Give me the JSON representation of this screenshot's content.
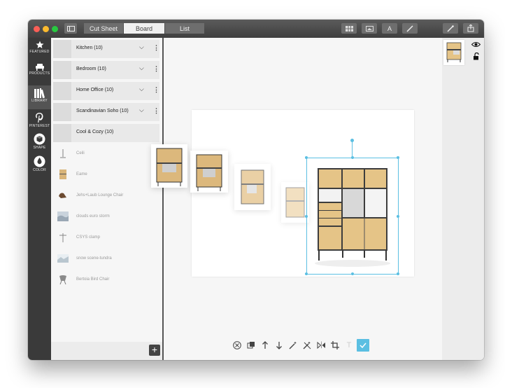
{
  "window": {
    "tabs": [
      {
        "label": "Cut Sheet",
        "active": false
      },
      {
        "label": "Board",
        "active": true
      },
      {
        "label": "List",
        "active": false
      }
    ]
  },
  "sidebar_rail": {
    "items": [
      {
        "label": "FEATURED",
        "icon": "star-icon"
      },
      {
        "label": "PRODUCTS",
        "icon": "armchair-icon"
      },
      {
        "label": "LIBRARY",
        "icon": "books-icon",
        "active": true
      },
      {
        "label": "PINTEREST",
        "icon": "pinterest-icon"
      },
      {
        "label": "SHAPE",
        "icon": "shape-icon"
      },
      {
        "label": "COLOR",
        "icon": "droplet-icon"
      }
    ]
  },
  "library": {
    "collections": [
      {
        "label": "Kitchen (10)"
      },
      {
        "label": "Bedroom (10)"
      },
      {
        "label": "Home Office (10)"
      },
      {
        "label": "Scandinavian Soho (10)"
      },
      {
        "label": "Cool & Cozy (10)"
      }
    ],
    "items": [
      {
        "label": "Ceili"
      },
      {
        "label": "Eame"
      },
      {
        "label": "Jehs+Laub Lounge Chair"
      },
      {
        "label": "clouds euro storm"
      },
      {
        "label": "CSYS clamp"
      },
      {
        "label": "snow scene-tundra"
      },
      {
        "label": "Bertoia Bird Chair"
      }
    ]
  },
  "toolbar": {
    "icons": [
      "close-circle-icon",
      "duplicate-icon",
      "bring-forward-icon",
      "send-backward-icon",
      "magic-wand-icon",
      "magic-wand-off-icon",
      "flip-icon",
      "crop-icon",
      "text-icon",
      "confirm-check-icon"
    ]
  },
  "colors": {
    "selection": "#5bbfe2",
    "titlebar": "#4a4a4a",
    "rail": "#3a3a3a"
  }
}
